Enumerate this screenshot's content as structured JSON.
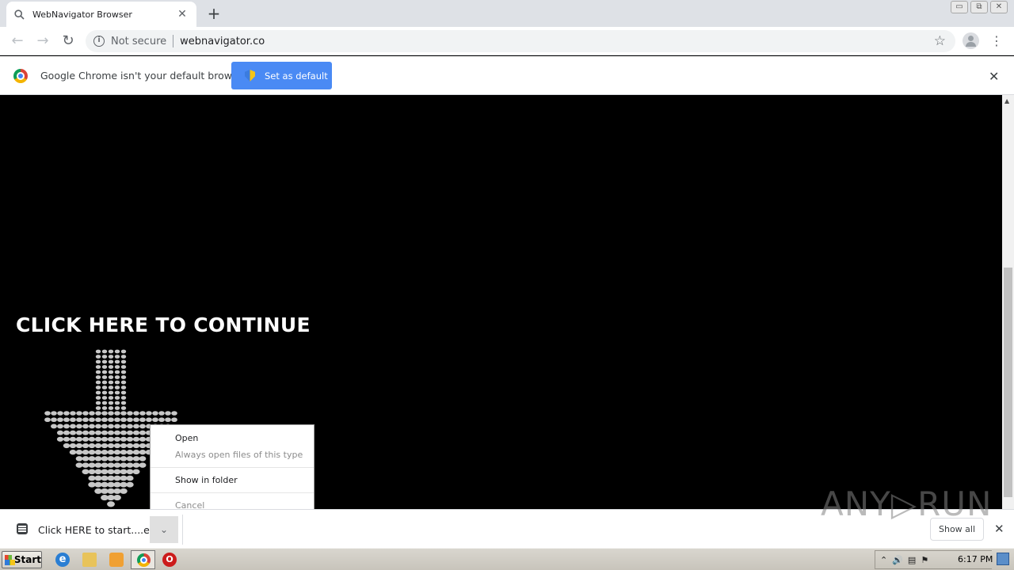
{
  "browser": {
    "tab": {
      "title": "WebNavigator Browser",
      "close_glyph": "✕"
    },
    "new_tab_glyph": "+",
    "window_buttons": [
      "▭",
      "⧉",
      "✕"
    ],
    "nav": {
      "back": "←",
      "forward": "→",
      "reload": "↻"
    },
    "omnibox": {
      "security_label": "Not secure",
      "url": "webnavigator.co"
    },
    "star_glyph": "☆",
    "menu_glyph": "⋮"
  },
  "infobar": {
    "message": "Google Chrome isn't your default browser",
    "button_label": "Set as default",
    "close_glyph": "✕"
  },
  "page": {
    "headline": "CLICK HERE TO CONTINUE"
  },
  "context_menu": {
    "items": [
      {
        "label": "Open",
        "enabled": true
      },
      {
        "label": "Always open files of this type",
        "enabled": false
      },
      {
        "label": "Show in folder",
        "enabled": true
      },
      {
        "label": "Cancel",
        "enabled": false
      }
    ]
  },
  "download_shelf": {
    "filename": "Click HERE to start....exe",
    "menu_glyph": "⌄",
    "show_all_label": "Show all",
    "close_glyph": "✕",
    "watermark": "ANY▷RUN"
  },
  "taskbar": {
    "start_label": "Start",
    "clock": "6:17 PM",
    "tray_glyphs": [
      "⌃",
      "🔊",
      "▤",
      "⚑"
    ]
  }
}
